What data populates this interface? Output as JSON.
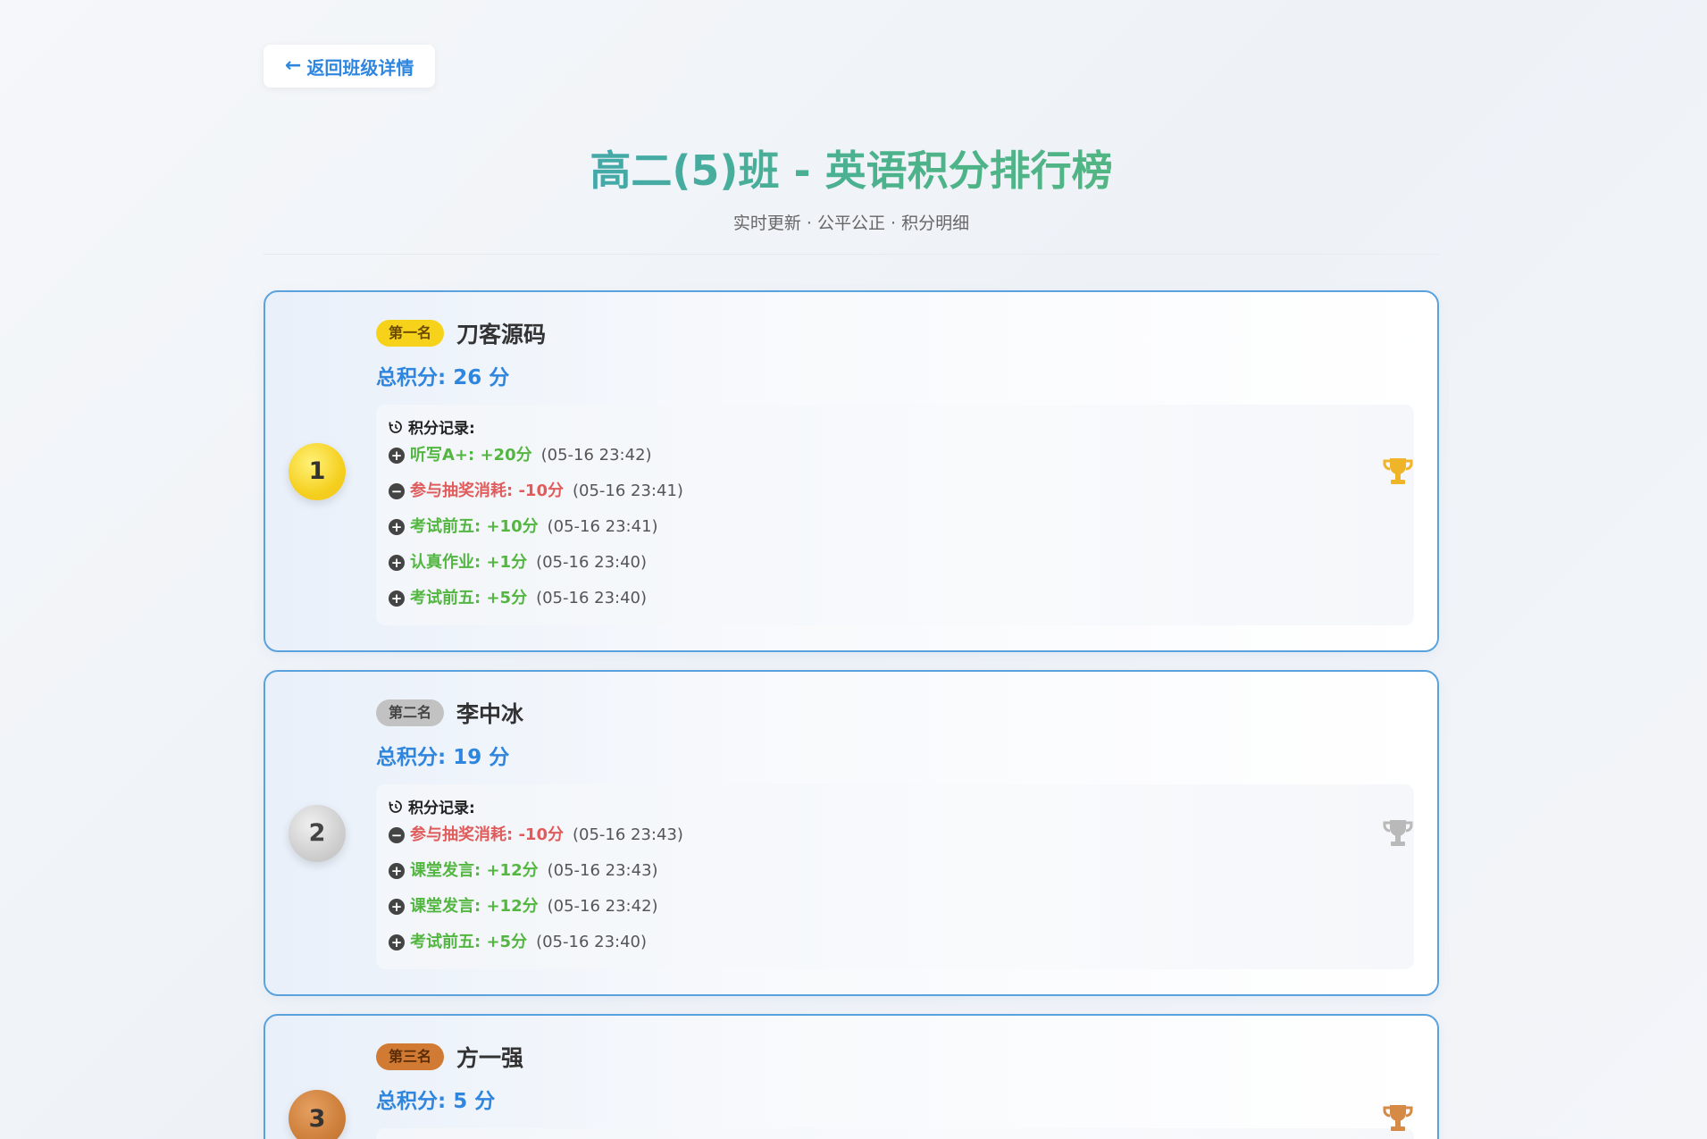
{
  "back_label": "返回班级详情",
  "title": "高二(5)班 - 英语积分排行榜",
  "subtitle": "实时更新 · 公平公正 · 积分明细",
  "records_title": "积分记录:",
  "colors": {
    "accent": "#2f86df",
    "plus": "#52b640",
    "minus": "#e05c5c",
    "border": "#5aa2de",
    "gold": "#f5d020",
    "silver": "#c2c2c2",
    "bronze": "#cd7f3a"
  },
  "students": [
    {
      "rank": "1",
      "badge": "第一名",
      "name": "刀客源码",
      "total": "总积分: 26 分",
      "trophy": "trophy-gold-icon",
      "records": [
        {
          "sign": "+",
          "label": "听写A+: +20分",
          "time": "(05-16 23:42)"
        },
        {
          "sign": "-",
          "label": "参与抽奖消耗: -10分",
          "time": "(05-16 23:41)"
        },
        {
          "sign": "+",
          "label": "考试前五: +10分",
          "time": "(05-16 23:41)"
        },
        {
          "sign": "+",
          "label": "认真作业: +1分",
          "time": "(05-16 23:40)"
        },
        {
          "sign": "+",
          "label": "考试前五: +5分",
          "time": "(05-16 23:40)"
        }
      ]
    },
    {
      "rank": "2",
      "badge": "第二名",
      "name": "李中冰",
      "total": "总积分: 19 分",
      "trophy": "trophy-silver-icon",
      "records": [
        {
          "sign": "-",
          "label": "参与抽奖消耗: -10分",
          "time": "(05-16 23:43)"
        },
        {
          "sign": "+",
          "label": "课堂发言: +12分",
          "time": "(05-16 23:43)"
        },
        {
          "sign": "+",
          "label": "课堂发言: +12分",
          "time": "(05-16 23:42)"
        },
        {
          "sign": "+",
          "label": "考试前五: +5分",
          "time": "(05-16 23:40)"
        }
      ]
    },
    {
      "rank": "3",
      "badge": "第三名",
      "name": "方一强",
      "total": "总积分: 5 分",
      "trophy": "trophy-bronze-icon",
      "records": []
    }
  ]
}
